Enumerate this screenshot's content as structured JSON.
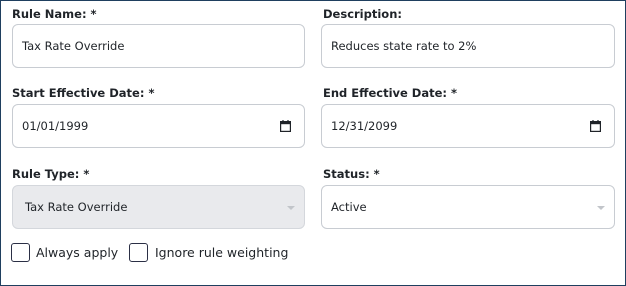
{
  "form": {
    "rule_name": {
      "label": "Rule Name: *",
      "value": "Tax Rate Override"
    },
    "description": {
      "label": "Description:",
      "value": "Reduces state rate to 2%"
    },
    "start_date": {
      "label": "Start Effective Date: *",
      "value": "01/01/1999"
    },
    "end_date": {
      "label": "End Effective Date: *",
      "value": "12/31/2099"
    },
    "rule_type": {
      "label": "Rule Type: *",
      "value": "Tax Rate Override",
      "disabled": true
    },
    "status": {
      "label": "Status: *",
      "value": "Active"
    },
    "always_apply": {
      "label": "Always apply",
      "checked": false
    },
    "ignore_weighting": {
      "label": "Ignore rule weighting",
      "checked": false
    }
  },
  "icons": {
    "date_picker": "calendar-icon",
    "select_caret": "chevron-down-icon"
  }
}
